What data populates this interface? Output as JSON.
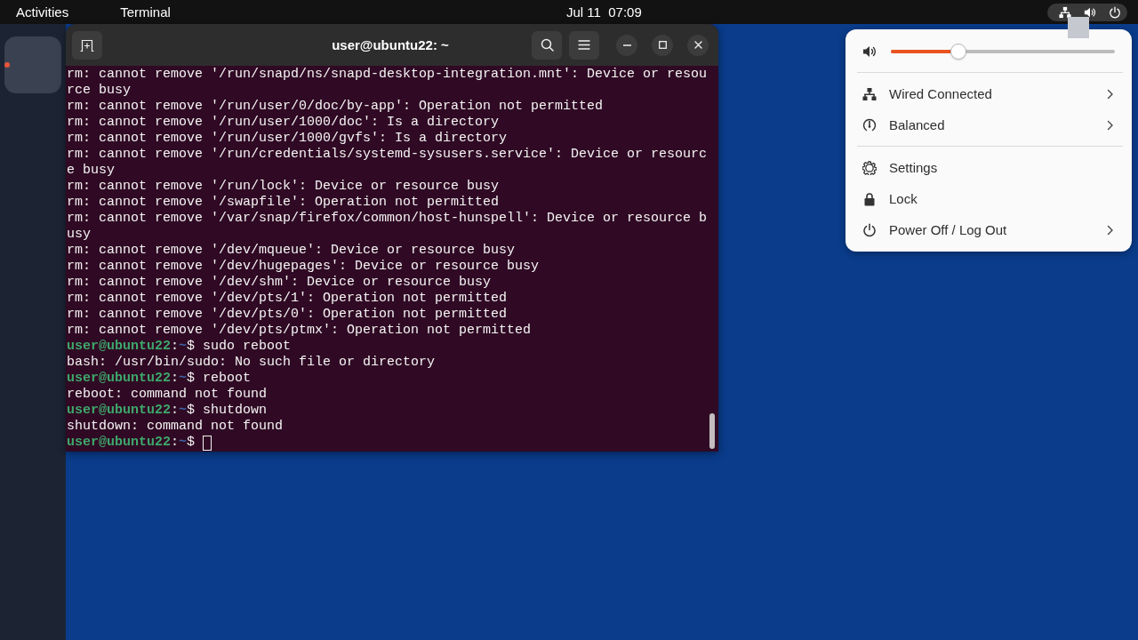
{
  "top_bar": {
    "activities": "Activities",
    "app_menu": "Terminal",
    "clock": "Jul 11  07:09"
  },
  "dock": {
    "items": [
      {
        "running": true
      }
    ]
  },
  "terminal": {
    "title": "user@ubuntu22: ~",
    "lines": [
      {
        "kind": "output",
        "text": "rm: cannot remove '/run/snapd/ns/snapd-desktop-integration.mnt': Device or resource busy"
      },
      {
        "kind": "output",
        "text": "rm: cannot remove '/run/user/0/doc/by-app': Operation not permitted"
      },
      {
        "kind": "output",
        "text": "rm: cannot remove '/run/user/1000/doc': Is a directory"
      },
      {
        "kind": "output",
        "text": "rm: cannot remove '/run/user/1000/gvfs': Is a directory"
      },
      {
        "kind": "output",
        "text": "rm: cannot remove '/run/credentials/systemd-sysusers.service': Device or resource busy"
      },
      {
        "kind": "output",
        "text": "rm: cannot remove '/run/lock': Device or resource busy"
      },
      {
        "kind": "output",
        "text": "rm: cannot remove '/swapfile': Operation not permitted"
      },
      {
        "kind": "output",
        "text": "rm: cannot remove '/var/snap/firefox/common/host-hunspell': Device or resource busy"
      },
      {
        "kind": "output",
        "text": "rm: cannot remove '/dev/mqueue': Device or resource busy"
      },
      {
        "kind": "output",
        "text": "rm: cannot remove '/dev/hugepages': Device or resource busy"
      },
      {
        "kind": "output",
        "text": "rm: cannot remove '/dev/shm': Device or resource busy"
      },
      {
        "kind": "output",
        "text": "rm: cannot remove '/dev/pts/1': Operation not permitted"
      },
      {
        "kind": "output",
        "text": "rm: cannot remove '/dev/pts/0': Operation not permitted"
      },
      {
        "kind": "output",
        "text": "rm: cannot remove '/dev/pts/ptmx': Operation not permitted"
      },
      {
        "kind": "prompt",
        "user_host": "user@ubuntu22",
        "separator": ":",
        "path": "~",
        "symbol": "$",
        "command": "sudo reboot",
        "cursor": false
      },
      {
        "kind": "output",
        "text": "bash: /usr/bin/sudo: No such file or directory"
      },
      {
        "kind": "prompt",
        "user_host": "user@ubuntu22",
        "separator": ":",
        "path": "~",
        "symbol": "$",
        "command": "reboot",
        "cursor": false
      },
      {
        "kind": "output",
        "text": "reboot: command not found"
      },
      {
        "kind": "prompt",
        "user_host": "user@ubuntu22",
        "separator": ":",
        "path": "~",
        "symbol": "$",
        "command": "shutdown",
        "cursor": false
      },
      {
        "kind": "output",
        "text": "shutdown: command not found"
      },
      {
        "kind": "prompt",
        "user_host": "user@ubuntu22",
        "separator": ":",
        "path": "~",
        "symbol": "$",
        "cursor": true
      }
    ]
  },
  "system_menu": {
    "volume": {
      "level": 0.3
    },
    "sections": [
      {
        "items": [
          {
            "kind": "network",
            "label": "Wired Connected",
            "submenu": true
          },
          {
            "kind": "power_mode",
            "label": "Balanced",
            "submenu": true
          }
        ]
      },
      {
        "items": [
          {
            "kind": "settings",
            "label": "Settings",
            "submenu": false
          },
          {
            "kind": "lock",
            "label": "Lock",
            "submenu": false
          },
          {
            "kind": "power",
            "label": "Power Off / Log Out",
            "submenu": true
          }
        ]
      }
    ]
  }
}
